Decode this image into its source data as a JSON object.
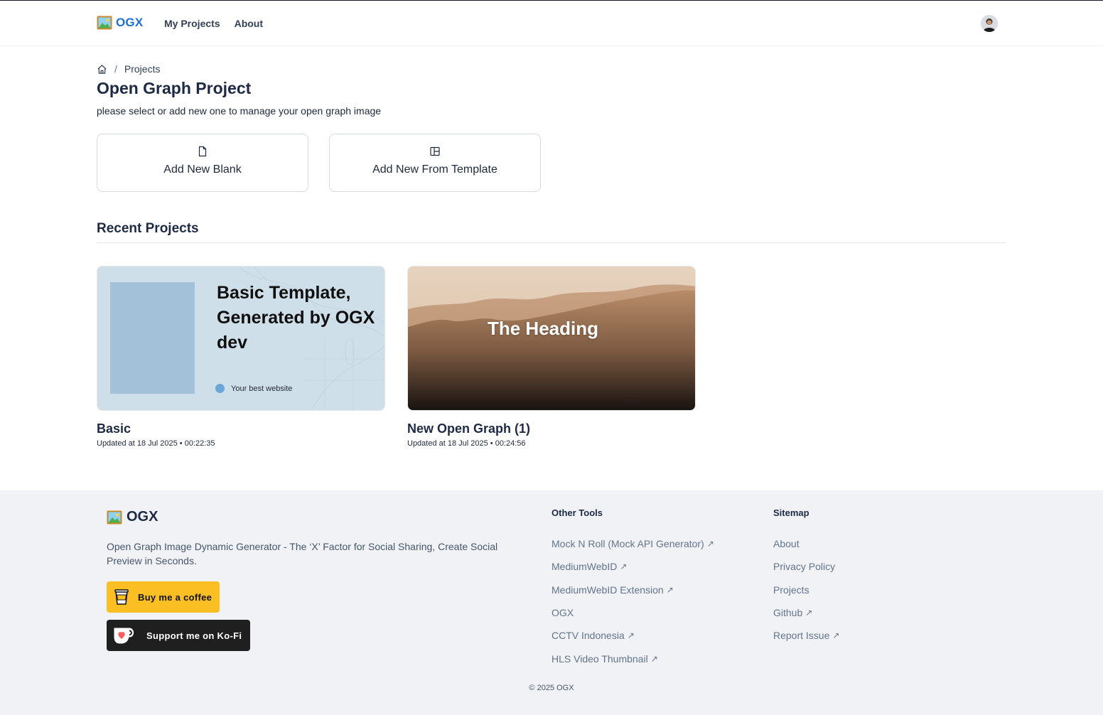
{
  "header": {
    "logo_text": "OGX",
    "nav": [
      "My Projects",
      "About"
    ]
  },
  "breadcrumb": {
    "separator": "/",
    "current": "Projects"
  },
  "page": {
    "title": "Open Graph Project",
    "subtitle": "please select or add new one to manage your open graph image"
  },
  "actions": {
    "blank_label": "Add New Blank",
    "template_label": "Add New From Template"
  },
  "recent": {
    "title": "Recent Projects",
    "projects": [
      {
        "name": "Basic",
        "updated": "Updated at 18 Jul 2025 • 00:22:35",
        "thumb_title": "Basic Template, Generated by OGX dev",
        "thumb_site": "Your best website"
      },
      {
        "name": "New Open Graph (1)",
        "updated": "Updated at 18 Jul 2025 • 00:24:56",
        "thumb_title": "The Heading"
      }
    ]
  },
  "footer": {
    "logo_text": "OGX",
    "description": "Open Graph Image Dynamic Generator - The ‘X’ Factor for Social Sharing, Create Social Preview in Seconds.",
    "coffee_label": "Buy me a coffee",
    "kofi_label": "Support me on Ko-Fi",
    "other_tools": {
      "title": "Other Tools",
      "items": [
        "Mock N Roll (Mock API Generator)",
        "MediumWebID",
        "MediumWebID Extension",
        "OGX",
        "CCTV Indonesia",
        "HLS Video Thumbnail"
      ]
    },
    "sitemap": {
      "title": "Sitemap",
      "items": [
        "About",
        "Privacy Policy",
        "Projects",
        "Github",
        "Report Issue"
      ]
    },
    "copyright": "© 2025 OGX"
  },
  "colors": {
    "brand": "#1d6fd6",
    "coffee": "#fbbf24",
    "kofi": "#1f1f1f",
    "footer_bg": "#f0f2f5"
  }
}
